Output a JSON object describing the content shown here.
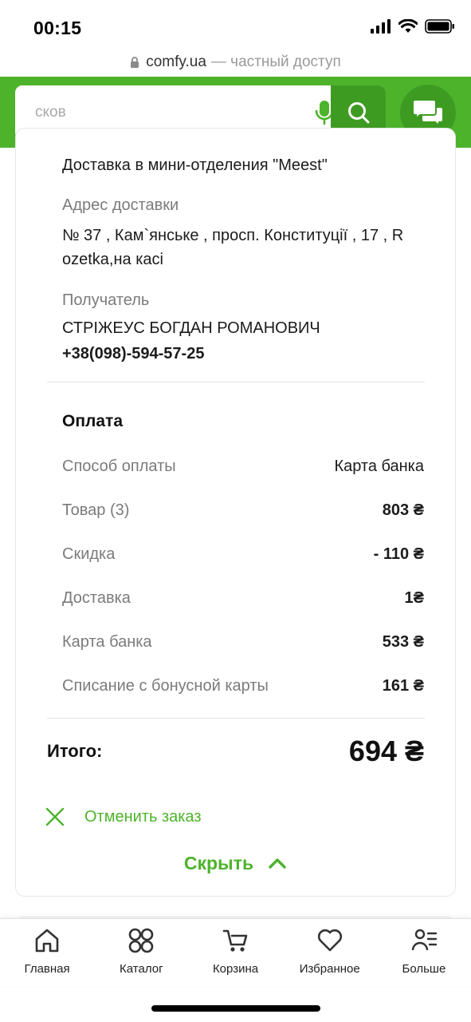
{
  "status_bar": {
    "time": "00:15"
  },
  "browser": {
    "domain": "comfy.ua",
    "access_note": "— частный доступ"
  },
  "search": {
    "placeholder": "сков"
  },
  "delivery": {
    "method": "Доставка в мини-отделения \"Meest\"",
    "address_label": "Адрес доставки",
    "address_line1": "№ 37 , Кам`янське , просп. Конституції , 17 , R",
    "address_line2": "ozetka,на касі",
    "recipient_label": "Получатель",
    "recipient_name": "СТРІЖЕУС БОГДАН РОМАНОВИЧ",
    "recipient_phone": "+38(098)-594-57-25"
  },
  "payment": {
    "title": "Оплата",
    "rows": [
      {
        "label": "Способ оплаты",
        "value": "Карта банка"
      },
      {
        "label": "Товар (3)",
        "value": "803 ₴"
      },
      {
        "label": "Скидка",
        "value": "- 110 ₴"
      },
      {
        "label": "Доставка",
        "value": "1₴"
      },
      {
        "label": "Карта банка",
        "value": "533 ₴"
      },
      {
        "label": "Списание с бонусной карты",
        "value": "161 ₴"
      }
    ],
    "total_label": "Итого:",
    "total_value": "694 ₴"
  },
  "actions": {
    "cancel_label": "Отменить заказ",
    "hide_label": "Скрыть"
  },
  "bottom_nav": [
    {
      "label": "Главная",
      "icon": "home-icon"
    },
    {
      "label": "Каталог",
      "icon": "catalog-icon"
    },
    {
      "label": "Корзина",
      "icon": "cart-icon"
    },
    {
      "label": "Избранное",
      "icon": "heart-icon"
    },
    {
      "label": "Больше",
      "icon": "more-icon"
    }
  ],
  "colors": {
    "brand_green": "#4db32b",
    "brand_green_dark": "#3e9b22"
  }
}
